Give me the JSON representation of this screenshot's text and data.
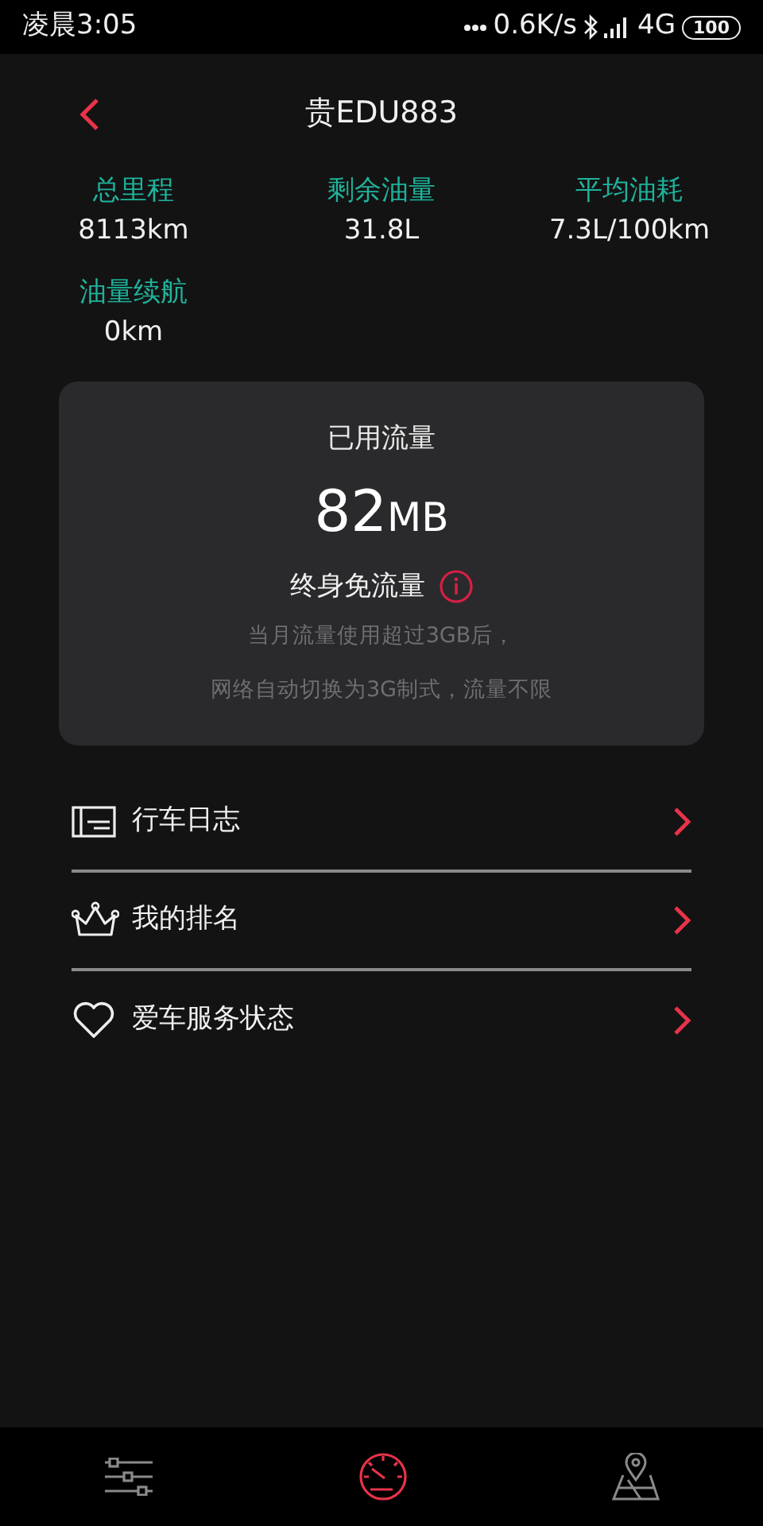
{
  "status_bar": {
    "time": "凌晨3:05",
    "net_speed": "0.6K/s",
    "network": "4G",
    "battery": "100"
  },
  "header": {
    "title": "贵EDU883"
  },
  "stats": [
    {
      "label": "总里程",
      "value": "8113km"
    },
    {
      "label": "剩余油量",
      "value": "31.8L"
    },
    {
      "label": "平均油耗",
      "value": "7.3L/100km"
    },
    {
      "label": "油量续航",
      "value": "0km"
    }
  ],
  "data_card": {
    "title": "已用流量",
    "value": "82",
    "unit": "MB",
    "plan": "终身免流量",
    "note_lines": [
      "当月流量使用超过3GB后，",
      "网络自动切换为3G制式，流量不限"
    ]
  },
  "menu": [
    {
      "kind": "log",
      "label": "行车日志"
    },
    {
      "kind": "crown",
      "label": "我的排名"
    },
    {
      "kind": "heart",
      "label": "爱车服务状态"
    }
  ],
  "bottom_nav": [
    {
      "kind": "sliders",
      "selected": false
    },
    {
      "kind": "gauge",
      "selected": true
    },
    {
      "kind": "map",
      "selected": false
    }
  ]
}
